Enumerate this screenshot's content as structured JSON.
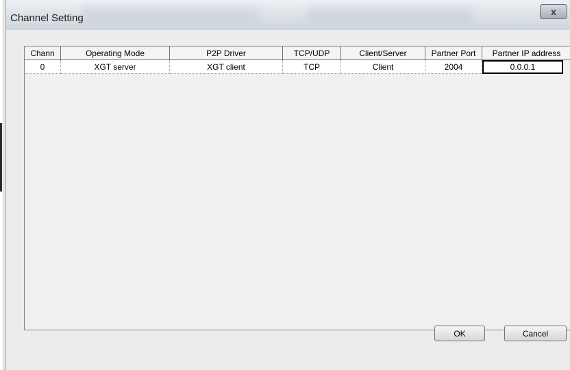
{
  "window": {
    "title": "Channel Setting",
    "close_label": "x"
  },
  "table": {
    "columns": [
      "Chann",
      "Operating Mode",
      "P2P Driver",
      "TCP/UDP",
      "Client/Server",
      "Partner Port",
      "Partner IP address"
    ],
    "rows": [
      [
        "0",
        "XGT server",
        "XGT client",
        "TCP",
        "Client",
        "2004",
        "0.0.0.1"
      ]
    ],
    "selected_cell": "Partner IP address"
  },
  "buttons": {
    "ok_label": "OK",
    "cancel_label": "Cancel"
  }
}
